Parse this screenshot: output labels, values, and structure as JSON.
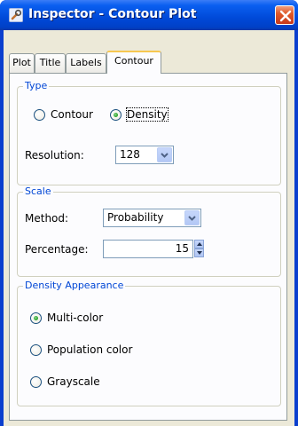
{
  "window": {
    "title": "Inspector - Contour Plot"
  },
  "tabs": [
    {
      "label": "Plot",
      "active": false
    },
    {
      "label": "Title",
      "active": false
    },
    {
      "label": "Labels",
      "active": false
    },
    {
      "label": "Contour",
      "active": true
    }
  ],
  "type_group": {
    "legend": "Type",
    "options": [
      {
        "label": "Contour",
        "checked": false
      },
      {
        "label": "Density",
        "checked": true
      }
    ],
    "resolution_label": "Resolution:",
    "resolution_value": "128"
  },
  "scale_group": {
    "legend": "Scale",
    "method_label": "Method:",
    "method_value": "Probability",
    "percentage_label": "Percentage:",
    "percentage_value": "15"
  },
  "density_group": {
    "legend": "Density Appearance",
    "options": [
      {
        "label": "Multi-color",
        "checked": true
      },
      {
        "label": "Population color",
        "checked": false
      },
      {
        "label": "Grayscale",
        "checked": false
      }
    ]
  },
  "colors": {
    "titlebar": "#0049d8",
    "legend_text": "#0046d5",
    "radio_dot": "#21a121",
    "active_tab_accent": "#f7c750"
  }
}
